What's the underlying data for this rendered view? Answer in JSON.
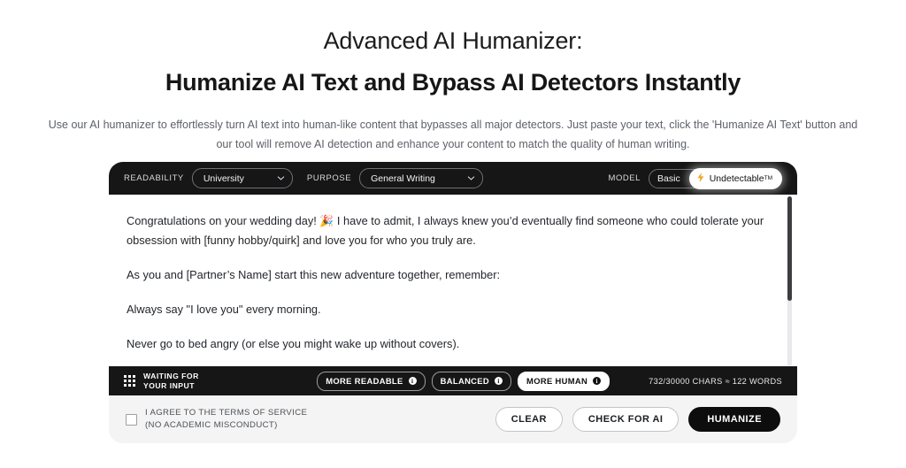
{
  "hero": {
    "title_line1": "Advanced AI Humanizer:",
    "title_line2": "Humanize AI Text and Bypass AI Detectors Instantly",
    "subtitle": "Use our AI humanizer to effortlessly turn AI text into human-like content that bypasses all major detectors. Just paste your text, click the 'Humanize AI Text' button and our tool will remove AI detection and enhance your content to match the quality of human writing."
  },
  "toolbar": {
    "readability_label": "READABILITY",
    "readability_value": "University",
    "purpose_label": "PURPOSE",
    "purpose_value": "General Writing",
    "model_label": "MODEL",
    "model_basic": "Basic",
    "model_undetectable": "Undetectable",
    "model_undetectable_tm": "TM",
    "bolt_icon": "⚡"
  },
  "editor": {
    "paragraphs": [
      "Congratulations on your wedding day! 🎉 I have to admit, I always knew you’d eventually find someone who could tolerate your obsession with [funny hobby/quirk] and love you for who you truly are.",
      "As you and [Partner’s Name] start this new adventure together, remember:",
      "Always say \"I love you\" every morning.",
      "Never go to bed angry (or else you might wake up without covers)."
    ]
  },
  "status": {
    "state_text": "WAITING FOR\nYOUR INPUT",
    "pills": [
      {
        "label": "MORE READABLE",
        "active": false
      },
      {
        "label": "BALANCED",
        "active": false
      },
      {
        "label": "MORE HUMAN",
        "active": true
      }
    ],
    "char_count": "732/30000 CHARS ≈ 122 WORDS"
  },
  "footer": {
    "terms_text": "I AGREE TO THE TERMS OF SERVICE\n(NO ACADEMIC MISCONDUCT)",
    "buttons": [
      {
        "label": "CLEAR",
        "style": "outline"
      },
      {
        "label": "CHECK FOR AI",
        "style": "outline"
      },
      {
        "label": "HUMANIZE",
        "style": "primary"
      }
    ]
  },
  "colors": {
    "dark": "#161616",
    "accent_bolt": "#f0a52b",
    "card_bg": "#f4f4f4",
    "primary_btn": "#0d0d0d"
  }
}
